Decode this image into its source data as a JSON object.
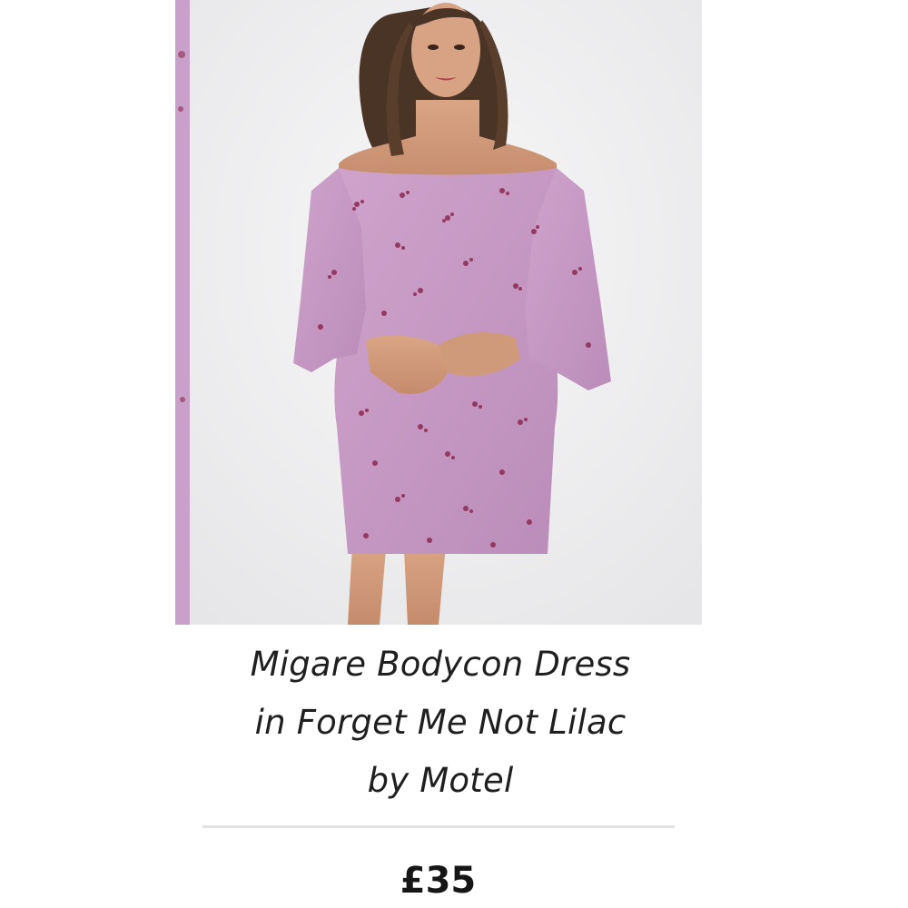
{
  "product": {
    "image_alt": "Model wearing lilac off-shoulder floral bodycon dress with fluted sleeves",
    "title_lines": [
      "Migare Bodycon Dress",
      "in Forget Me Not Lilac",
      "by Motel"
    ],
    "price": "£35"
  },
  "colors": {
    "dress": "#c79ac4",
    "print": "#8c2a52",
    "background": "#eeeeef",
    "text": "#1f1f1f",
    "divider": "#e2e2e2"
  }
}
